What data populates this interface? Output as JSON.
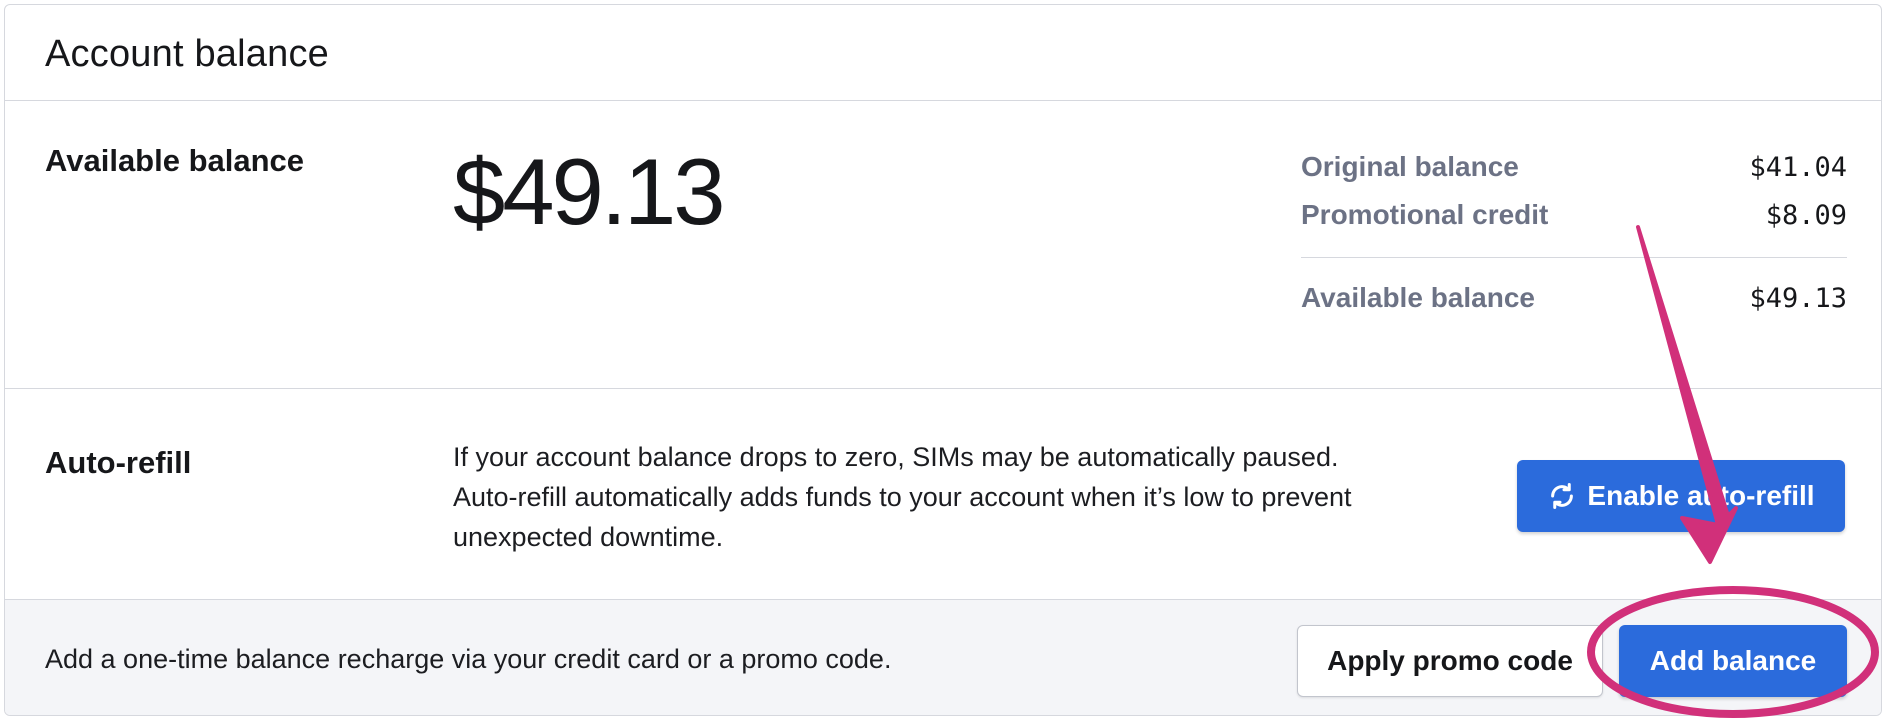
{
  "header": {
    "title": "Account balance"
  },
  "balance": {
    "label": "Available balance",
    "amount": "$49.13",
    "breakdown": [
      {
        "label": "Original balance",
        "value": "$41.04"
      },
      {
        "label": "Promotional credit",
        "value": "$8.09"
      }
    ],
    "total": {
      "label": "Available balance",
      "value": "$49.13"
    }
  },
  "auto_refill": {
    "label": "Auto-refill",
    "description_line1": "If your account balance drops to zero, SIMs may be automatically paused.",
    "description_line2": "Auto-refill automatically adds funds to your account when it’s low to prevent",
    "description_line3": "unexpected downtime.",
    "enable_button": "Enable auto-refill",
    "enable_icon": "refresh-icon"
  },
  "footer": {
    "text": "Add a one-time balance recharge via your credit card or a promo code.",
    "promo_button": "Apply promo code",
    "add_button": "Add balance"
  },
  "colors": {
    "primary": "#2b6bdc",
    "annotation": "#d1307a",
    "muted_text": "#6c7285",
    "footer_bg": "#f4f5f8"
  }
}
